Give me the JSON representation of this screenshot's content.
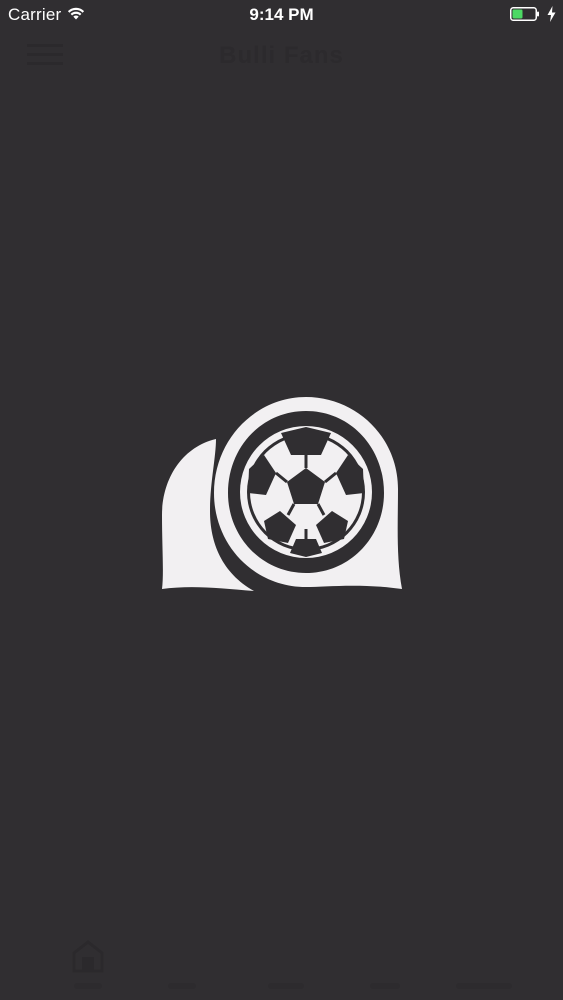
{
  "status_bar": {
    "carrier": "Carrier",
    "time": "9:14 PM",
    "battery_color": "#4cd964"
  },
  "splash": {
    "logo_icon": "soccer-ball-chat-logo-icon",
    "logo_color": "#f2f0f2",
    "background_color": "#302e31"
  },
  "nav": {
    "menu_icon": "hamburger-menu-icon",
    "title": "Bulli Fans"
  },
  "tab_bar": {
    "tabs": [
      {
        "icon": "home-icon"
      },
      {
        "icon": "tab-icon"
      },
      {
        "icon": "tab-icon"
      },
      {
        "icon": "tab-icon"
      },
      {
        "icon": "tab-icon"
      }
    ]
  }
}
